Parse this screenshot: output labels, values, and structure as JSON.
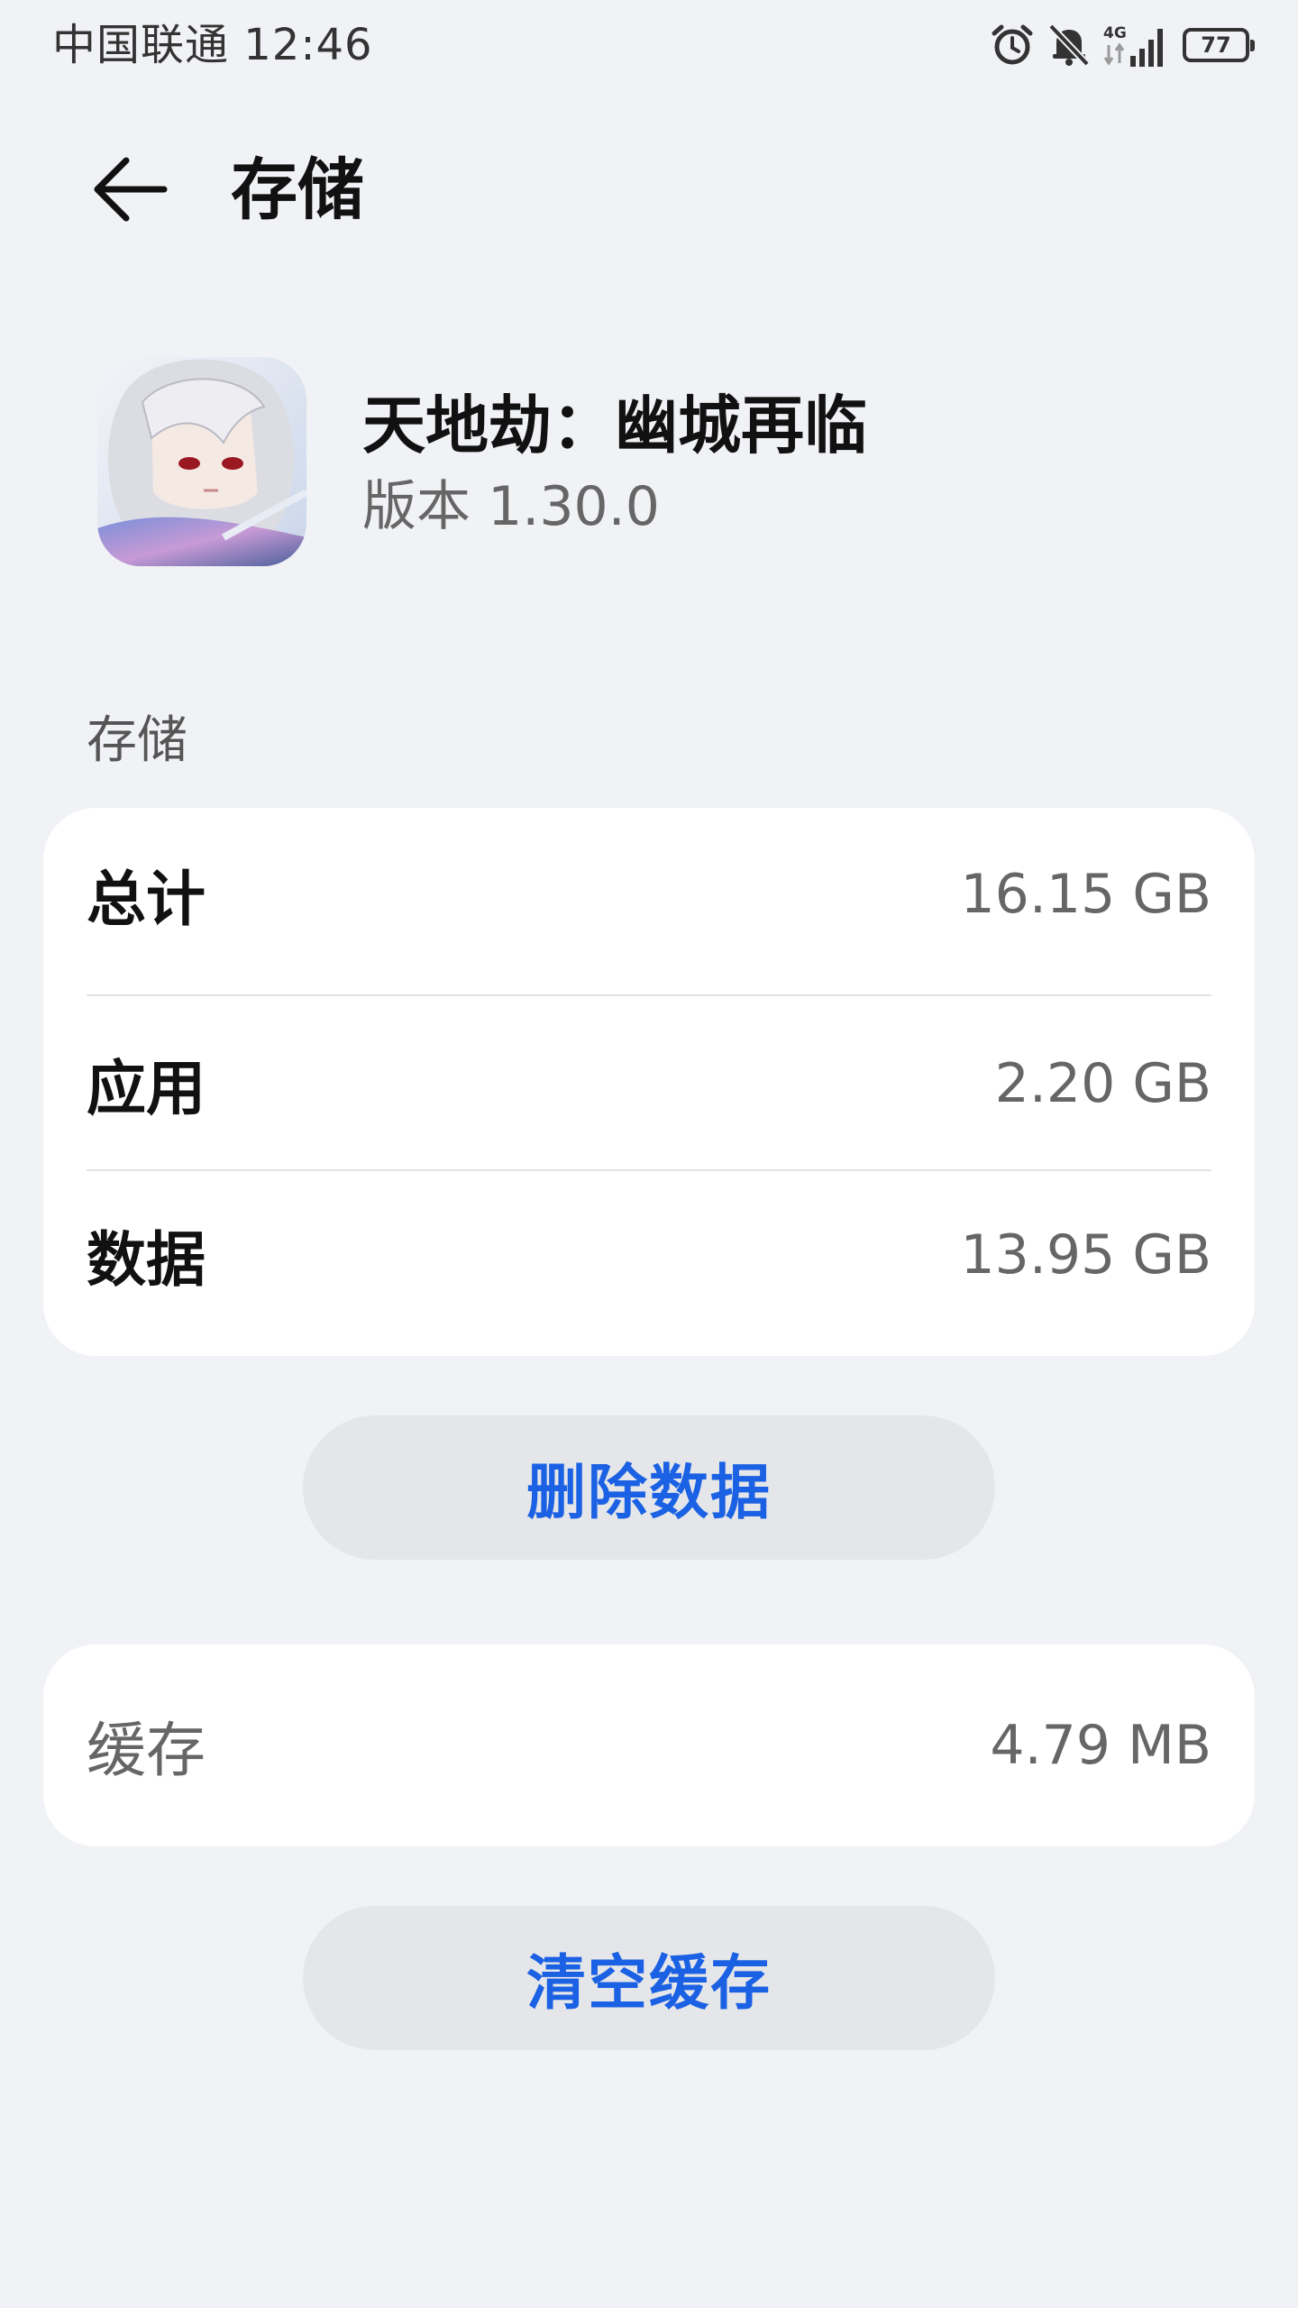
{
  "status_bar": {
    "carrier_time": "中国联通 12:46",
    "network": "4G",
    "battery": "77",
    "icons": [
      "alarm-icon",
      "bell-off-icon",
      "signal-4g-icon",
      "battery-icon"
    ]
  },
  "header": {
    "back_icon": "arrow-left-icon",
    "title": "存储"
  },
  "app": {
    "name": "天地劫：幽城再临",
    "version": "版本 1.30.0"
  },
  "storage": {
    "section_label": "存储",
    "rows": [
      {
        "label": "总计",
        "value": "16.15 GB"
      },
      {
        "label": "应用",
        "value": "2.20 GB"
      },
      {
        "label": "数据",
        "value": "13.95 GB"
      }
    ],
    "delete_button": "删除数据"
  },
  "cache": {
    "label": "缓存",
    "value": "4.79 MB",
    "clear_button": "清空缓存"
  },
  "colors": {
    "background": "#f1f2f5",
    "card": "#ffffff",
    "accent": "#1b61e4",
    "button_bg": "#e5e6e9"
  }
}
